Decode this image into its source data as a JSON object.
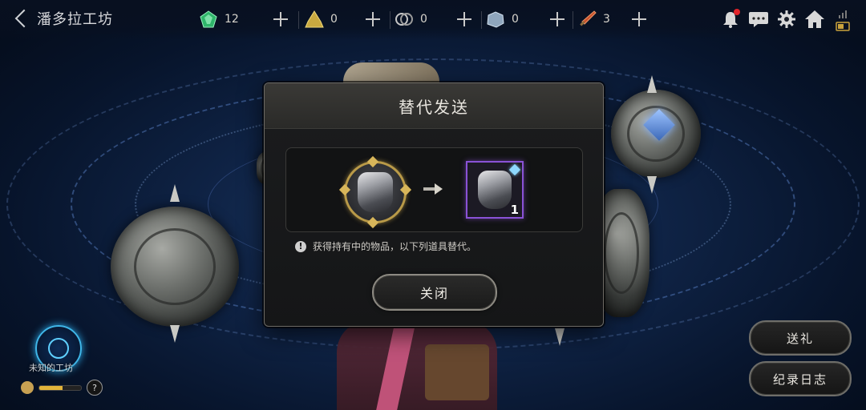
{
  "header": {
    "title": "潘多拉工坊",
    "currencies": [
      {
        "icon": "green-crystal-icon",
        "value": "12"
      },
      {
        "icon": "gold-ore-icon",
        "value": "0"
      },
      {
        "icon": "wire-coil-icon",
        "value": "0"
      },
      {
        "icon": "silver-ore-icon",
        "value": "0"
      },
      {
        "icon": "red-dagger-icon",
        "value": "3"
      }
    ]
  },
  "modal": {
    "title": "替代发送",
    "to_item_count": "1",
    "notice": "获得持有中的物品，以下列道具替代。",
    "close_label": "关闭"
  },
  "workshop": {
    "label": "未知的工坊",
    "progress": 0.55,
    "help": "?"
  },
  "buttons": {
    "gift_label": "送礼",
    "log_label": "纪录日志"
  },
  "colors": {
    "accent_gold": "#b99a48",
    "item_border_purple": "#8a52d6",
    "notification_red": "#e0242a",
    "workshop_glow": "#3fb6e8"
  }
}
